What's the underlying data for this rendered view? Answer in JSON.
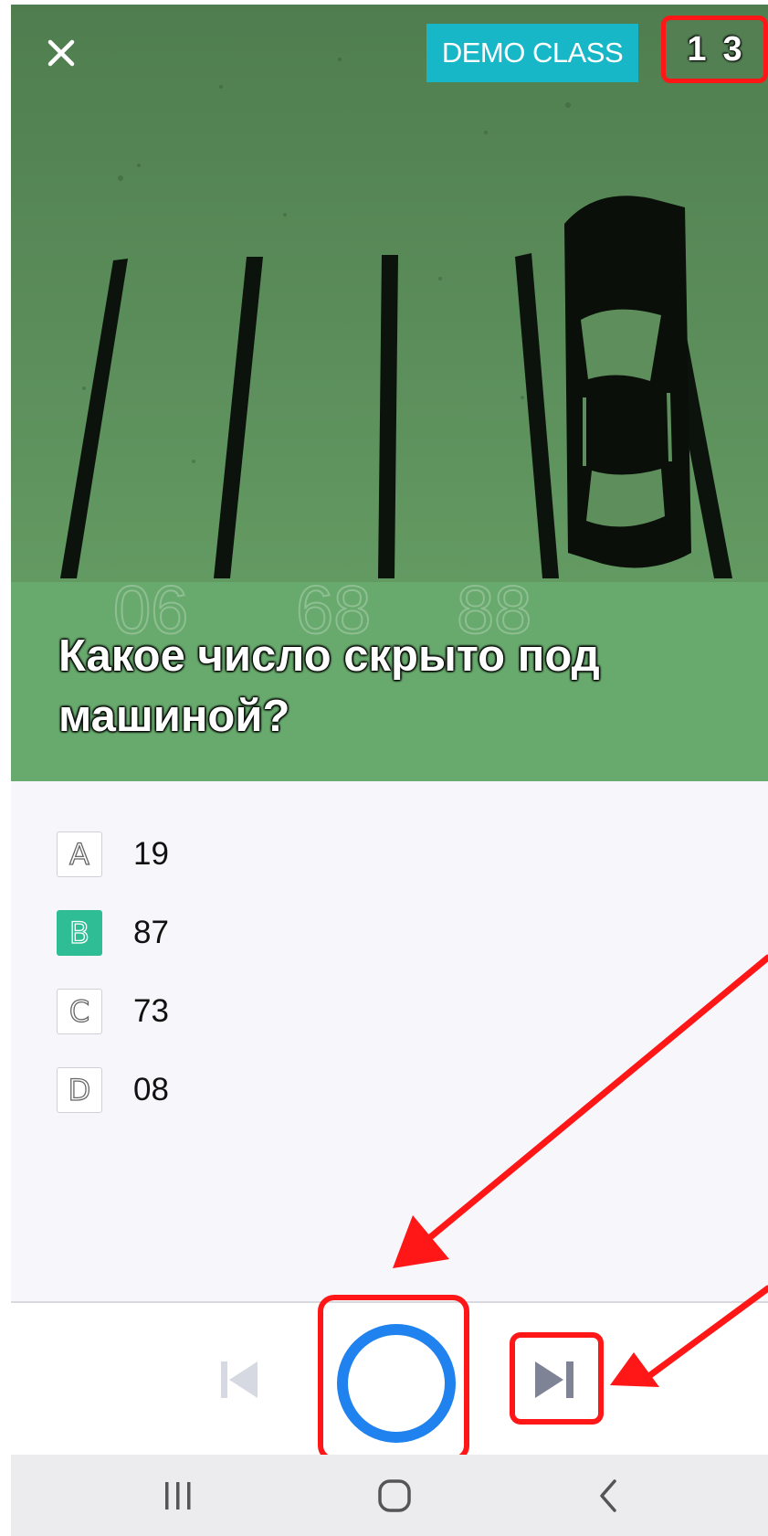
{
  "header": {
    "badge": "DEMO CLASS",
    "counter_current": "1",
    "counter_total": "3"
  },
  "question": {
    "text": "Какое число скрыто под машиной?"
  },
  "answers": [
    {
      "letter": "A",
      "text": "19",
      "selected": false
    },
    {
      "letter": "B",
      "text": "87",
      "selected": true
    },
    {
      "letter": "C",
      "text": "73",
      "selected": false
    },
    {
      "letter": "D",
      "text": "08",
      "selected": false
    }
  ],
  "photo": {
    "slot_numbers": [
      "06",
      "68",
      "88"
    ]
  },
  "colors": {
    "badge": "#17b7c7",
    "selected": "#2ebd95",
    "record": "#1f82ee",
    "annotation": "#ff1616"
  },
  "icons": {
    "close": "close-icon",
    "prev": "skip-previous-icon",
    "record": "record-circle-icon",
    "next": "skip-next-icon",
    "recent_apps": "recent-apps-icon",
    "home": "home-icon",
    "back": "back-icon"
  }
}
